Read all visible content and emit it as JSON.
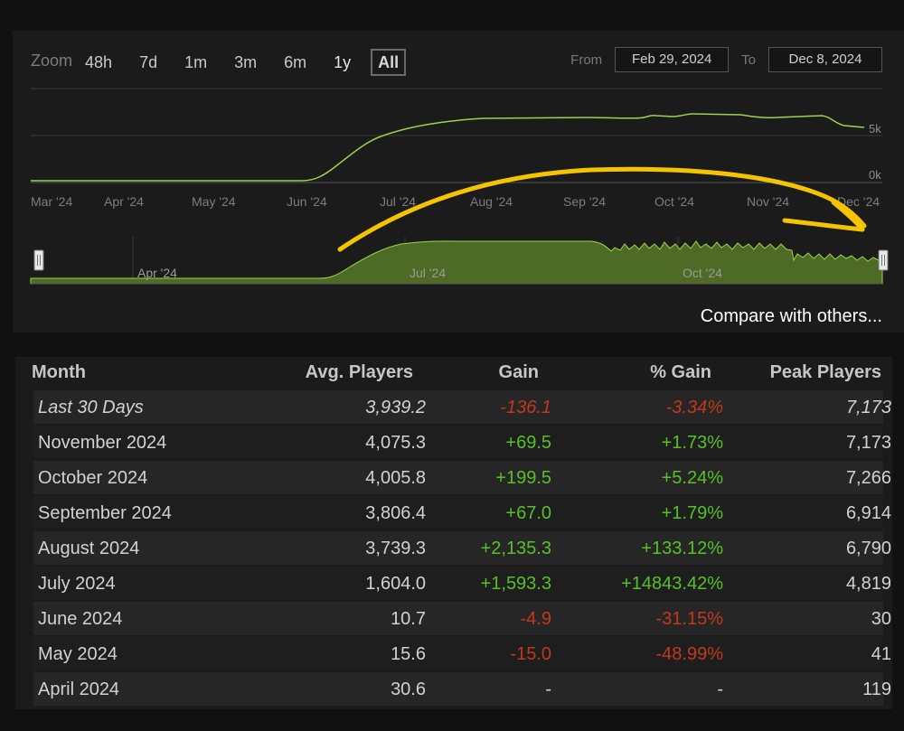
{
  "zoom": {
    "label": "Zoom",
    "buttons": [
      "48h",
      "7d",
      "1m",
      "3m",
      "6m",
      "1y",
      "All"
    ],
    "active": "All"
  },
  "range": {
    "from_label": "From",
    "from_value": "Feb 29, 2024",
    "to_label": "To",
    "to_value": "Dec 8, 2024"
  },
  "main_chart": {
    "y_ticks": [
      "5k",
      "0k"
    ],
    "x_ticks": [
      "Mar '24",
      "Apr '24",
      "May '24",
      "Jun '24",
      "Jul '24",
      "Aug '24",
      "Sep '24",
      "Oct '24",
      "Nov '24",
      "Dec '24"
    ]
  },
  "navigator": {
    "x_ticks": [
      "Apr '24",
      "Jul '24",
      "Oct '24"
    ]
  },
  "compare_link": "Compare with others...",
  "colors": {
    "line": "#9ed34a",
    "navigator_fill": "#4e6b26",
    "annotation": "#f5c400",
    "positive": "#55c126",
    "negative": "#c0391b"
  },
  "table": {
    "headers": [
      "Month",
      "Avg. Players",
      "Gain",
      "% Gain",
      "Peak Players"
    ],
    "rows": [
      {
        "month": "Last 30 Days",
        "avg": "3,939.2",
        "gain": "-136.1",
        "pct": "-3.34%",
        "peak": "7,173",
        "sign": "neg",
        "italic": true
      },
      {
        "month": "November 2024",
        "avg": "4,075.3",
        "gain": "+69.5",
        "pct": "+1.73%",
        "peak": "7,173",
        "sign": "pos"
      },
      {
        "month": "October 2024",
        "avg": "4,005.8",
        "gain": "+199.5",
        "pct": "+5.24%",
        "peak": "7,266",
        "sign": "pos"
      },
      {
        "month": "September 2024",
        "avg": "3,806.4",
        "gain": "+67.0",
        "pct": "+1.79%",
        "peak": "6,914",
        "sign": "pos"
      },
      {
        "month": "August 2024",
        "avg": "3,739.3",
        "gain": "+2,135.3",
        "pct": "+133.12%",
        "peak": "6,790",
        "sign": "pos"
      },
      {
        "month": "July 2024",
        "avg": "1,604.0",
        "gain": "+1,593.3",
        "pct": "+14843.42%",
        "peak": "4,819",
        "sign": "pos"
      },
      {
        "month": "June 2024",
        "avg": "10.7",
        "gain": "-4.9",
        "pct": "-31.15%",
        "peak": "30",
        "sign": "neg"
      },
      {
        "month": "May 2024",
        "avg": "15.6",
        "gain": "-15.0",
        "pct": "-48.99%",
        "peak": "41",
        "sign": "neg"
      },
      {
        "month": "April 2024",
        "avg": "30.6",
        "gain": "-",
        "pct": "-",
        "peak": "119",
        "sign": "none"
      }
    ]
  }
}
